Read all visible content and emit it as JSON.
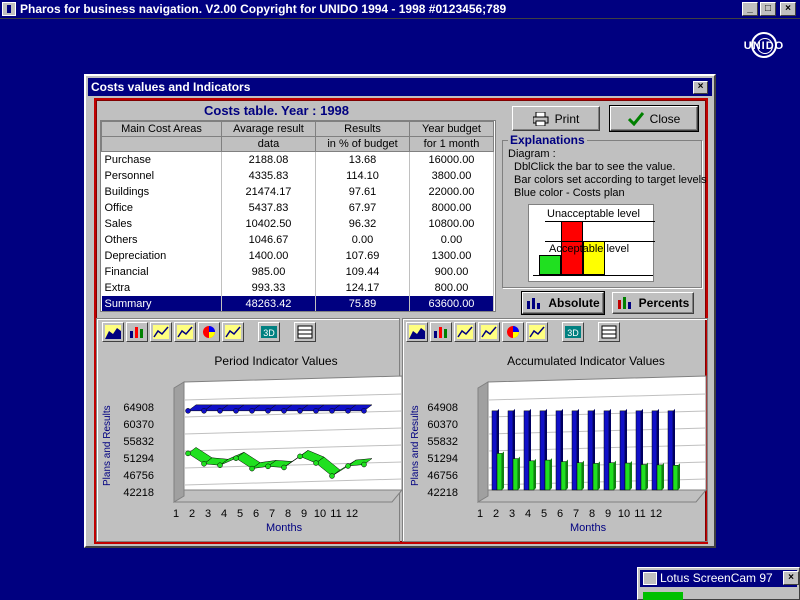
{
  "app": {
    "title": "Pharos for business navigation. V2.00 Copyright for UNIDO 1994 - 1998  #0123456;789",
    "logo_text": "UNIDO",
    "buttons": {
      "minimize": "_",
      "maximize": "□",
      "close": "×"
    }
  },
  "dialog": {
    "title": "Costs values and Indicators",
    "close_label": "×",
    "table_title": "Costs table.  Year : 1998",
    "columns": [
      [
        "Main Cost Areas",
        ""
      ],
      [
        "Avarage result",
        "data"
      ],
      [
        "Results",
        "in % of budget"
      ],
      [
        "Year budget",
        "for 1 month"
      ]
    ],
    "rows": [
      [
        "Purchase",
        "2188.08",
        "13.68",
        "16000.00"
      ],
      [
        "Personnel",
        "4335.83",
        "114.10",
        "3800.00"
      ],
      [
        "Buildings",
        "21474.17",
        "97.61",
        "22000.00"
      ],
      [
        "Office",
        "5437.83",
        "67.97",
        "8000.00"
      ],
      [
        "Sales",
        "10402.50",
        "96.32",
        "10800.00"
      ],
      [
        "Others",
        "1046.67",
        "0.00",
        "0.00"
      ],
      [
        "Depreciation",
        "1400.00",
        "107.69",
        "1300.00"
      ],
      [
        "Financial",
        "985.00",
        "109.44",
        "900.00"
      ],
      [
        "Extra",
        "993.33",
        "124.17",
        "800.00"
      ],
      [
        "Summary",
        "48263.42",
        "75.89",
        "63600.00"
      ]
    ],
    "print_label": "Print",
    "close_button_label": "Close",
    "explanations": {
      "heading": "Explanations",
      "lines": [
        "Diagram :",
        "DblClick the bar to see the value.",
        "Bar colors set according to target levels",
        "Blue color - Costs plan"
      ],
      "unacceptable": "Unacceptable level",
      "acceptable": "Acceptable level"
    },
    "absolute_label": "Absolute",
    "percents_label": "Percents",
    "toolbar_3d_label": "3D"
  },
  "colors": {
    "plan": "#1010c8",
    "result": "#20e020",
    "bad": "#ff0000",
    "ok": "#ffff00",
    "good": "#20e020"
  },
  "chart_data": [
    {
      "type": "line",
      "title": "Period Indicator Values",
      "ylabel": "Plans and Results",
      "xlabel": "Months",
      "yticks": [
        "64908",
        "60370",
        "55832",
        "51294",
        "46756",
        "42218"
      ],
      "ylim": [
        42218,
        64908
      ],
      "categories": [
        "1",
        "2",
        "3",
        "4",
        "5",
        "6",
        "7",
        "8",
        "9",
        "10",
        "11",
        "12"
      ],
      "series": [
        {
          "values": [
            63600,
            63600,
            63600,
            63600,
            63600,
            63600,
            63600,
            63600,
            63600,
            63600,
            63600,
            63600
          ]
        },
        {
          "values": [
            52100,
            49300,
            48900,
            50800,
            48000,
            48600,
            48300,
            51300,
            49500,
            46000,
            48700,
            49100
          ]
        }
      ]
    },
    {
      "type": "bar",
      "title": "Accumulated Indicator Values",
      "ylabel": "Plans and Results",
      "xlabel": "Months",
      "yticks": [
        "64908",
        "60370",
        "55832",
        "51294",
        "46756",
        "42218"
      ],
      "ylim": [
        42218,
        64908
      ],
      "categories": [
        "1",
        "2",
        "3",
        "4",
        "5",
        "6",
        "7",
        "8",
        "9",
        "10",
        "11",
        "12"
      ],
      "series": [
        {
          "values": [
            63600,
            63600,
            63600,
            63600,
            63600,
            63600,
            63600,
            63600,
            63600,
            63600,
            63600,
            63600
          ]
        },
        {
          "values": [
            52100,
            50700,
            50100,
            50300,
            49900,
            49600,
            49400,
            49600,
            49500,
            49100,
            49000,
            48900
          ]
        }
      ]
    }
  ]
}
